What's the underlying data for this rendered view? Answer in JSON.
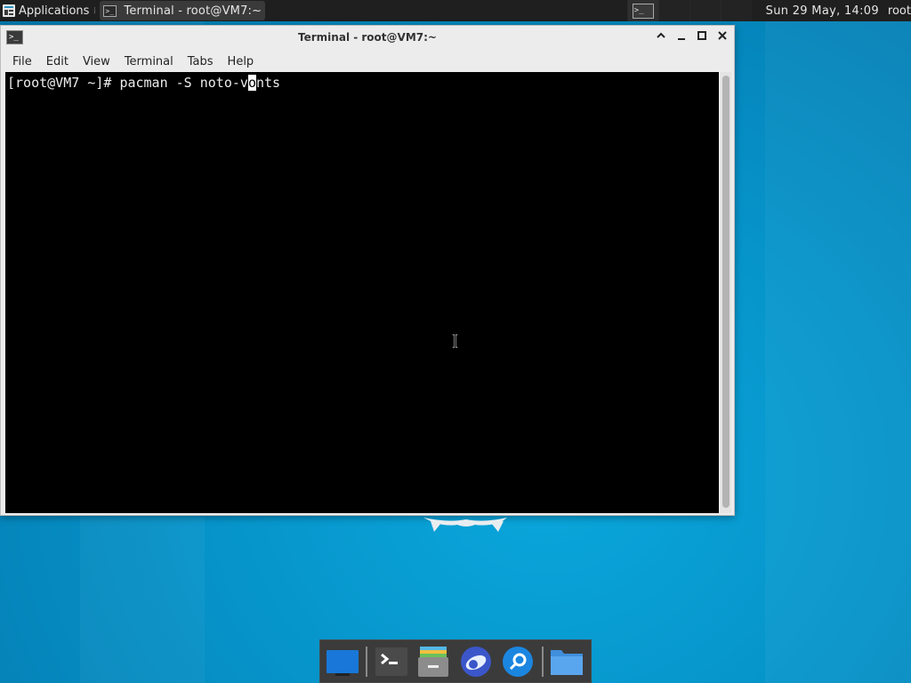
{
  "top_panel": {
    "applications_label": "Applications",
    "task_label": "Terminal - root@VM7:~",
    "clock": "Sun 29 May, 14:09",
    "user": "root"
  },
  "window": {
    "title": "Terminal - root@VM7:~",
    "menu": [
      "File",
      "Edit",
      "View",
      "Terminal",
      "Tabs",
      "Help"
    ]
  },
  "terminal": {
    "prompt": "[root@VM7 ~]# ",
    "command_before_cursor": "pacman -S noto-v",
    "cursor_char": "o",
    "command_after_cursor": "nts"
  },
  "dock": {
    "items": [
      "desktop-icon",
      "terminal-icon",
      "archive-manager-icon",
      "web-browser-icon",
      "search-icon",
      "file-manager-icon"
    ]
  },
  "colors": {
    "desktop": "#0693c9",
    "panel": "#1f1f1f",
    "terminal_bg": "#000000",
    "terminal_fg": "#ececec"
  }
}
